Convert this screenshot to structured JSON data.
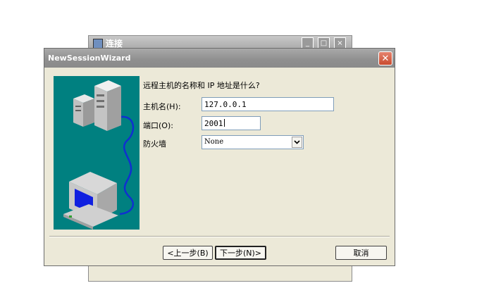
{
  "background_window": {
    "title": "连接",
    "buttons": [
      "_",
      "□",
      "×"
    ]
  },
  "dialog": {
    "title": "NewSessionWizard",
    "close_symbol": "✕",
    "question": "远程主机的名称和 IP 地址是什么?",
    "host": {
      "label": "主机名(H):",
      "value": "127.0.0.1"
    },
    "port": {
      "label": "端口(O):",
      "value": "2001"
    },
    "firewall": {
      "label": "防火墙",
      "value": "None"
    },
    "buttons": {
      "back": "<上一步(B)",
      "next": "下一步(N)>",
      "cancel": "取消"
    }
  },
  "colors": {
    "illustration_bg": "#008080",
    "dialog_bg": "#ece9d8",
    "title_bar": "#8f8f8f",
    "close_button": "#d05a3c"
  }
}
